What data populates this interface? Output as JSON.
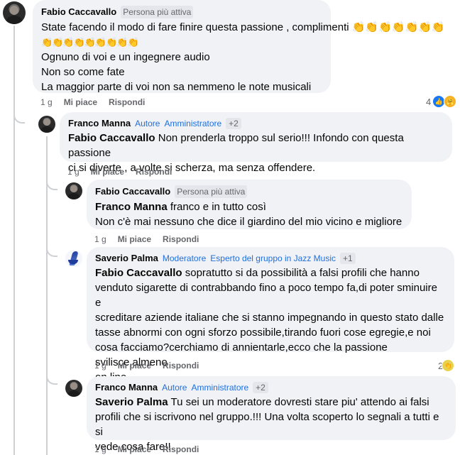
{
  "comments": [
    {
      "author": "Fabio Caccavallo",
      "badges": [
        "Persona più attiva"
      ],
      "lines": [
        "State facendo il modo di fare finire questa passione , complimenti 👏👏👏👏👏👏👏",
        "👏👏👏👏👏👏👏👏👏",
        "Ognuno di voi e un ingegnere audio",
        "Non so come fate",
        "La maggior parte di voi non sa nemmeno le note musicali"
      ],
      "time": "1 g",
      "like": "Mi piace",
      "reply": "Rispondi",
      "reactions_count": "4"
    },
    {
      "author": "Franco Manna",
      "badges": [
        "Autore",
        "Amministratore"
      ],
      "plus": "+2",
      "mention": "Fabio Caccavallo",
      "line1": " Non prenderla troppo sul serio!!! Infondo con questa passione",
      "line2": "ci si diverte , a volte si scherza, ma senza offendere.",
      "time": "1 g",
      "like": "Mi piace",
      "reply": "Rispondi"
    },
    {
      "author": "Fabio Caccavallo",
      "badges": [
        "Persona più attiva"
      ],
      "mention": "Franco Manna",
      "line1": " franco e in tutto così",
      "line2": "Non c'è mai nessuno che dice il giardino del mio vicino e migliore",
      "time": "1 g",
      "like": "Mi piace",
      "reply": "Rispondi"
    },
    {
      "author": "Saverio Palma",
      "badges": [
        "Moderatore",
        "Esperto del gruppo in Jazz Music"
      ],
      "plus": "+1",
      "mention": "Fabio Caccavallo",
      "line1": " sopratutto si da possibilità a falsi profili che hanno",
      "lines": [
        "venduto sigarette di contrabbando fino a poco tempo fa,di poter sminuire e",
        "screditare aziende italiane che si stanno impegnando in questo stato dalle",
        "tasse abnormi con ogni sforzo possibile,tirando fuori cose egregie,e noi",
        "cosa facciamo?cerchiamo di annientarle,ecco che la passione svilisce,almeno",
        "on line"
      ],
      "time": "1 g",
      "like": "Mi piace",
      "reply": "Rispondi",
      "reactions_count": "2"
    },
    {
      "author": "Franco Manna",
      "badges": [
        "Autore",
        "Amministratore"
      ],
      "plus": "+2",
      "mention": "Saverio Palma",
      "line1": " Tu sei un moderatore dovresti stare piu' attendo ai falsi",
      "lines": [
        "profili che si iscrivono nel gruppo.!!! Una volta scoperto lo segnali a tutti e si",
        "vede cosa fare!!"
      ],
      "time": "1 g",
      "like": "Mi piace",
      "reply": "Rispondi"
    }
  ],
  "icons": {
    "like": "thumbs-up-icon",
    "care": "care-icon",
    "clap": "clap-icon"
  }
}
